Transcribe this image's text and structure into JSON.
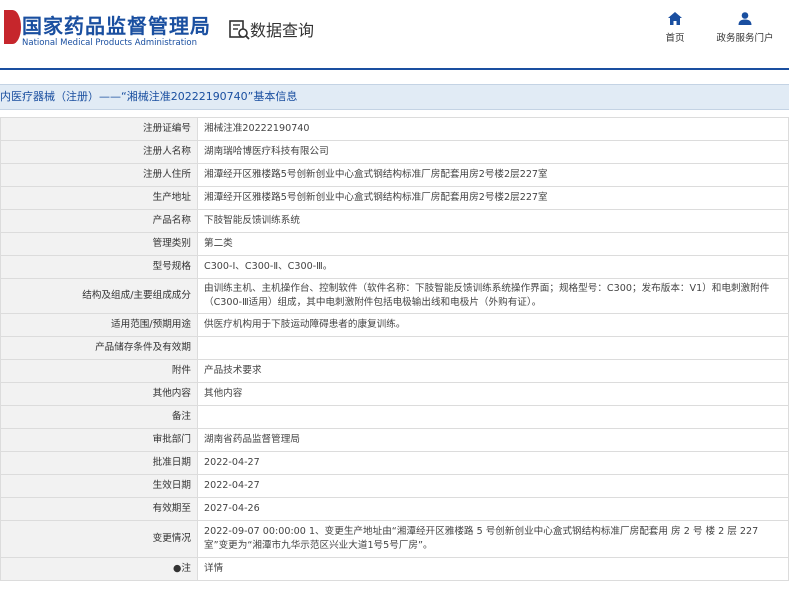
{
  "header": {
    "logo_cn": "国家药品监督管理局",
    "logo_en": "National Medical Products Administration",
    "query_title": "数据查询",
    "nav": [
      {
        "label": "首页",
        "icon": "home-icon"
      },
      {
        "label": "政务服务门户",
        "icon": "user-icon"
      }
    ]
  },
  "page_title": "内医疗器械（注册）——“湘械注准20222190740”基本信息",
  "rows": [
    {
      "key": "注册证编号",
      "value": "湘械注准20222190740"
    },
    {
      "key": "注册人名称",
      "value": "湖南瑞哈博医疗科技有限公司"
    },
    {
      "key": "注册人住所",
      "value": "湘潭经开区雅楼路5号创新创业中心盒式钢结构标准厂房配套用房2号楼2层227室"
    },
    {
      "key": "生产地址",
      "value": "湘潭经开区雅楼路5号创新创业中心盒式钢结构标准厂房配套用房2号楼2层227室"
    },
    {
      "key": "产品名称",
      "value": "下肢智能反馈训练系统"
    },
    {
      "key": "管理类别",
      "value": "第二类"
    },
    {
      "key": "型号规格",
      "value": "C300-Ⅰ、C300-Ⅱ、C300-Ⅲ。"
    },
    {
      "key": "结构及组成/主要组成成分",
      "value": "由训练主机、主机操作台、控制软件（软件名称：下肢智能反馈训练系统操作界面；规格型号：C300；发布版本：V1）和电刺激附件（C300-Ⅲ适用）组成，其中电刺激附件包括电极输出线和电极片（外购有证）。"
    },
    {
      "key": "适用范围/预期用途",
      "value": "供医疗机构用于下肢运动障碍患者的康复训练。"
    },
    {
      "key": "产品储存条件及有效期",
      "value": ""
    },
    {
      "key": "附件",
      "value": "产品技术要求"
    },
    {
      "key": "其他内容",
      "value": "其他内容"
    },
    {
      "key": "备注",
      "value": ""
    },
    {
      "key": "审批部门",
      "value": "湖南省药品监督管理局"
    },
    {
      "key": "批准日期",
      "value": "2022-04-27"
    },
    {
      "key": "生效日期",
      "value": "2022-04-27"
    },
    {
      "key": "有效期至",
      "value": "2027-04-26"
    },
    {
      "key": "变更情况",
      "value": "2022-09-07 00:00:00 1、变更生产地址由“湘潭经开区雅楼路 5 号创新创业中心盒式钢结构标准厂房配套用 房 2 号 楼 2 层 227 室”变更为“湘潭市九华示范区兴业大道1号5号厂房”。"
    },
    {
      "key": "●注",
      "value": "详情"
    }
  ]
}
